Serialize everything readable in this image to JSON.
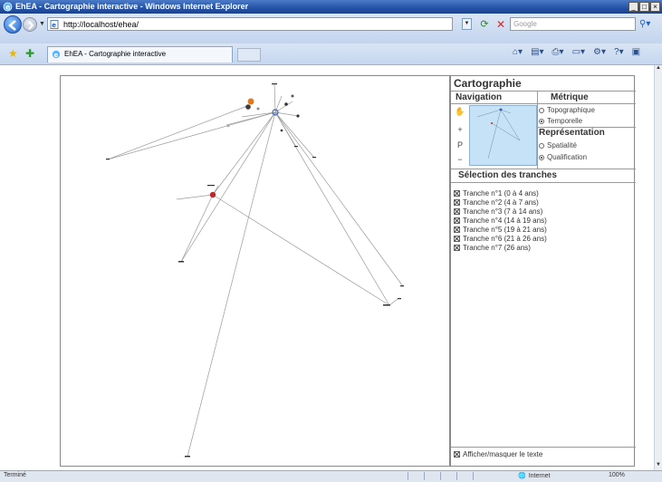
{
  "window": {
    "title": "EhEA - Cartographie interactive - Windows Internet Explorer",
    "controls": [
      "_",
      "□",
      "×"
    ]
  },
  "address_bar": {
    "url": "http://localhost/ehea/",
    "search_placeholder": "Google"
  },
  "tab": {
    "label": "EhEA - Cartographie interactive"
  },
  "panel": {
    "title": "Cartographie",
    "navigation_heading": "Navigation",
    "nav_tools": [
      "✋",
      "+",
      "P",
      "−"
    ],
    "metrique_heading": "Métrique",
    "metrique_options": [
      {
        "label": "Topographique",
        "selected": false
      },
      {
        "label": "Temporelle",
        "selected": true
      }
    ],
    "representation_heading": "Représentation",
    "representation_options": [
      {
        "label": "Spatialité",
        "selected": false
      },
      {
        "label": "Qualification",
        "selected": true
      }
    ],
    "tranches_heading": "Sélection des tranches",
    "tranches": [
      "Tranche n°1 (0 à 4 ans)",
      "Tranche n°2 (4 à 7 ans)",
      "Tranche n°3 (7 à 14 ans)",
      "Tranche n°4 (14 à 19 ans)",
      "Tranche n°5 (19 à 21 ans)",
      "Tranche n°6 (21 à 26 ans)",
      "Tranche n°7 (26 ans)"
    ],
    "toggle_text_label": "Afficher/masquer le texte"
  },
  "status_bar": {
    "status": "Terminé",
    "zone": "Internet",
    "zoom": "100%"
  },
  "colors": {
    "titlebar": "#2452a6",
    "minimap_bg": "#c6e2f7",
    "node_red": "#c0282d",
    "node_orange": "#e07a1f"
  }
}
